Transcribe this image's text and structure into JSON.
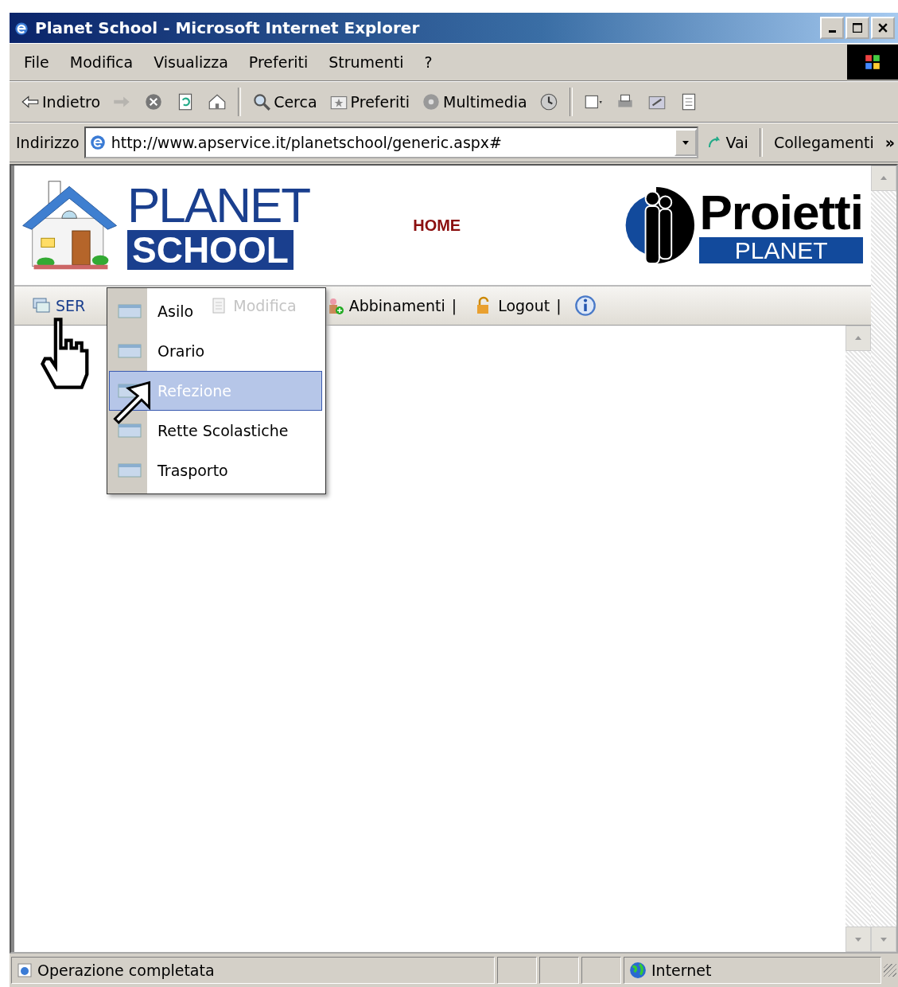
{
  "window": {
    "title": "Planet School - Microsoft Internet Explorer"
  },
  "menu_bar": [
    "File",
    "Modifica",
    "Visualizza",
    "Preferiti",
    "Strumenti",
    "?"
  ],
  "toolbar": [
    {
      "kind": "back",
      "label": "Indietro",
      "disabled": false
    },
    {
      "kind": "forward",
      "disabled": true
    },
    {
      "kind": "stop",
      "disabled": false
    },
    {
      "kind": "refresh",
      "disabled": false
    },
    {
      "kind": "home",
      "disabled": false
    },
    {
      "kind": "search",
      "label": "Cerca",
      "disabled": false
    },
    {
      "kind": "favorites",
      "label": "Preferiti",
      "disabled": false
    },
    {
      "kind": "media",
      "label": "Multimedia",
      "disabled": false
    },
    {
      "kind": "history",
      "disabled": false
    },
    {
      "kind": "mail",
      "disabled": false
    },
    {
      "kind": "print",
      "disabled": false
    },
    {
      "kind": "edit",
      "disabled": false
    },
    {
      "kind": "discuss",
      "disabled": false
    }
  ],
  "address_bar": {
    "label": "Indirizzo",
    "value": "http://www.apservice.it/planetschool/generic.aspx#",
    "go": "Vai",
    "links": "Collegamenti",
    "more": "»"
  },
  "header": {
    "logo_line_1": "PLANET",
    "logo_line_2": "SCHOOL",
    "home_link": "HOME",
    "brand_name": "Proietti",
    "brand_sub": "PLANET"
  },
  "nav": [
    {
      "kind": "services",
      "label": "SER",
      "disabled": false
    },
    {
      "kind": "edit",
      "label": "Modifica",
      "disabled": true
    },
    {
      "kind": "pairing",
      "label": "Abbinamenti",
      "disabled": false
    },
    {
      "kind": "separator",
      "label": "|"
    },
    {
      "kind": "logout",
      "label": "Logout",
      "disabled": false
    },
    {
      "kind": "separator",
      "label": "|"
    },
    {
      "kind": "info"
    }
  ],
  "dropdown": [
    {
      "label": "Asilo",
      "selected": false
    },
    {
      "label": "Orario",
      "selected": false
    },
    {
      "label": "Refezione",
      "selected": true
    },
    {
      "label": "Rette Scolastiche",
      "selected": false
    },
    {
      "label": "Trasporto",
      "selected": false
    }
  ],
  "status_bar": {
    "message": "Operazione completata",
    "zone": "Internet"
  }
}
